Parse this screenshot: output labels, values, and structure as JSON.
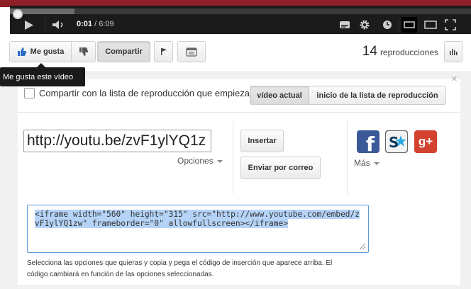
{
  "player": {
    "time_current": "0:01",
    "time_separator": "/",
    "time_total": "6:09",
    "progress_fraction": 0.0027,
    "buffered_fraction": 0.14
  },
  "actions": {
    "like_label": "Me gusta",
    "share_label": "Compartir",
    "views_count": "14",
    "views_label": "reproducciones"
  },
  "tooltip": {
    "text": "Me gusta este vídeo"
  },
  "share": {
    "playlist_label": "Compartir con la lista de reproducción que empieza por",
    "segment_current": "vídeo actual",
    "segment_start": "inicio de la lista de reproducción",
    "url_value": "http://youtu.be/zvF1ylYQ1z",
    "options_label": "Opciones",
    "insert_label": "Insertar",
    "email_label": "Enviar por correo",
    "more_label": "Más",
    "facebook_letter": "f",
    "gplus_label": "g+",
    "embed_code": "<iframe width=\"560\" height=\"315\" src=\"http://www.youtube.com/embed/zvF1ylYQ1zw\" frameborder=\"0\" allowfullscreen></iframe>",
    "help_text": "Selecciona las opciones que quieras y copia y pega el código de inserción que aparece arriba. El código cambiará en función de las opciones seleccionadas.",
    "close_symbol": "×"
  },
  "icons": {
    "play": "play-icon",
    "volume": "volume-icon",
    "captions": "captions-icon",
    "settings": "gear-icon",
    "watch_later": "clock-icon",
    "small_player": "small-player-icon",
    "large_player": "large-player-icon",
    "fullscreen": "fullscreen-icon",
    "like": "thumbs-up-icon",
    "dislike": "thumbs-down-icon",
    "flag": "flag-icon",
    "transcript": "transcript-icon",
    "stats": "bar-chart-icon"
  },
  "colors": {
    "accent_red": "#8f1f26",
    "player_bg": "#1b1b1b",
    "like_blue": "#2d6ec5",
    "selection_blue": "#b5d3f7",
    "facebook_blue": "#3b5998",
    "gplus_red": "#d3412f"
  }
}
